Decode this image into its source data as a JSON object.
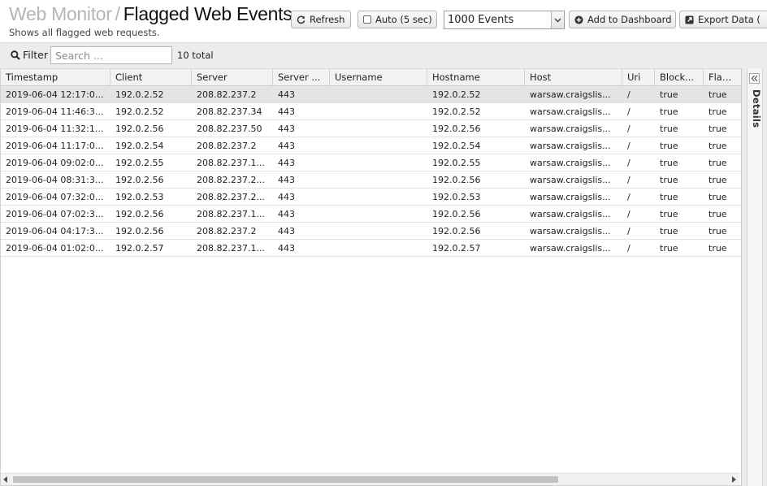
{
  "header": {
    "breadcrumb_parent": "Web Monitor",
    "breadcrumb_separator": "/",
    "title": "Flagged Web Events",
    "subtitle": "Shows all flagged web requests.",
    "refresh_label": "Refresh",
    "auto_label": "Auto (5 sec)",
    "auto_checked": false,
    "events_select_value": "1000 Events",
    "add_dashboard_label": "Add to Dashboard",
    "export_label": "Export Data ("
  },
  "filter": {
    "label": "Filter",
    "placeholder": "Search ...",
    "value": "",
    "total": "10 total"
  },
  "table": {
    "columns": [
      "Timestamp",
      "Client",
      "Server",
      "Server ...",
      "Username",
      "Hostname",
      "Host",
      "Uri",
      "Block...",
      "Flagg..."
    ],
    "rows": [
      [
        "2019-06-04 12:17:0...",
        "192.0.2.52",
        "208.82.237.2",
        "443",
        "",
        "192.0.2.52",
        "warsaw.craigslis...",
        "/",
        "true",
        "true"
      ],
      [
        "2019-06-04 11:46:3...",
        "192.0.2.52",
        "208.82.237.34",
        "443",
        "",
        "192.0.2.52",
        "warsaw.craigslis...",
        "/",
        "true",
        "true"
      ],
      [
        "2019-06-04 11:32:1...",
        "192.0.2.56",
        "208.82.237.50",
        "443",
        "",
        "192.0.2.56",
        "warsaw.craigslis...",
        "/",
        "true",
        "true"
      ],
      [
        "2019-06-04 11:17:0...",
        "192.0.2.54",
        "208.82.237.2",
        "443",
        "",
        "192.0.2.54",
        "warsaw.craigslis...",
        "/",
        "true",
        "true"
      ],
      [
        "2019-06-04 09:02:0...",
        "192.0.2.55",
        "208.82.237.1...",
        "443",
        "",
        "192.0.2.55",
        "warsaw.craigslis...",
        "/",
        "true",
        "true"
      ],
      [
        "2019-06-04 08:31:3...",
        "192.0.2.56",
        "208.82.237.2...",
        "443",
        "",
        "192.0.2.56",
        "warsaw.craigslis...",
        "/",
        "true",
        "true"
      ],
      [
        "2019-06-04 07:32:0...",
        "192.0.2.53",
        "208.82.237.2...",
        "443",
        "",
        "192.0.2.53",
        "warsaw.craigslis...",
        "/",
        "true",
        "true"
      ],
      [
        "2019-06-04 07:02:3...",
        "192.0.2.56",
        "208.82.237.1...",
        "443",
        "",
        "192.0.2.56",
        "warsaw.craigslis...",
        "/",
        "true",
        "true"
      ],
      [
        "2019-06-04 04:17:3...",
        "192.0.2.56",
        "208.82.237.2",
        "443",
        "",
        "192.0.2.56",
        "warsaw.craigslis...",
        "/",
        "true",
        "true"
      ],
      [
        "2019-06-04 01:02:0...",
        "192.0.2.57",
        "208.82.237.1...",
        "443",
        "",
        "192.0.2.57",
        "warsaw.craigslis...",
        "/",
        "true",
        "true"
      ]
    ],
    "selected_row": 0
  },
  "details_panel": {
    "label": "Details",
    "collapsed": true
  },
  "icons": {
    "refresh": "refresh-icon",
    "add": "plus-circle-icon",
    "export": "export-icon",
    "search": "search-icon",
    "dropdown": "chevron-down-icon",
    "collapse": "double-chevron-left-icon"
  },
  "colors": {
    "header_bg": "#ffffff",
    "toolbar_bg": "#ececec",
    "selected_row": "#e4e4e4",
    "breadcrumb_parent": "#b5b5b5"
  }
}
